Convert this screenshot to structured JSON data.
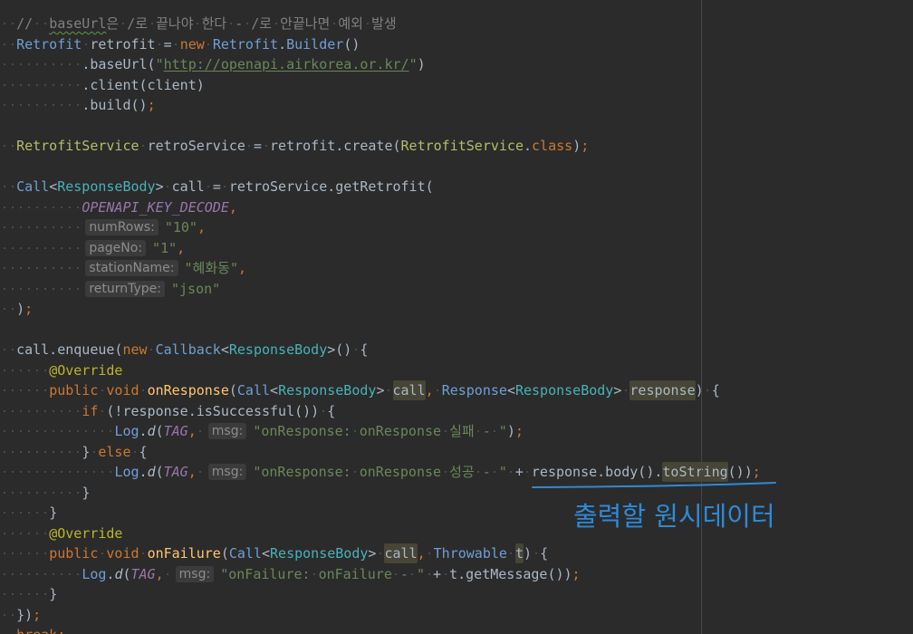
{
  "editor": {
    "lines": [
      [
        {
          "t": "  //  ",
          "c": "#808080"
        },
        {
          "t": "baseUrl",
          "c": "#808080",
          "wavy": true
        },
        {
          "t": "은 /로 끝나야 한다 - /로 안끝나면 예외 발생",
          "c": "#808080"
        }
      ],
      [
        {
          "t": "  "
        },
        {
          "t": "Retrofit",
          "c": "#6e9fd6"
        },
        {
          "t": " retrofit = "
        },
        {
          "t": "new",
          "c": "#cc7832"
        },
        {
          "t": " "
        },
        {
          "t": "Retrofit",
          "c": "#6e9fd6"
        },
        {
          "t": "."
        },
        {
          "t": "Builder",
          "c": "#6e9fd6"
        },
        {
          "t": "()"
        }
      ],
      [
        {
          "t": "          .baseUrl("
        },
        {
          "t": "\"",
          "c": "#6a8759"
        },
        {
          "t": "http://openapi.airkorea.or.kr/",
          "c": "#6a8759",
          "link": true
        },
        {
          "t": "\"",
          "c": "#6a8759"
        },
        {
          "t": ")"
        }
      ],
      [
        {
          "t": "          .client(client)"
        }
      ],
      [
        {
          "t": "          .build()"
        },
        {
          "t": ";",
          "c": "#cc7832"
        }
      ],
      [],
      [
        {
          "t": "  "
        },
        {
          "t": "RetrofitService",
          "c": "#b5bd68"
        },
        {
          "t": " retroService = retrofit.create("
        },
        {
          "t": "RetrofitService",
          "c": "#b5bd68"
        },
        {
          "t": "."
        },
        {
          "t": "class",
          "c": "#cc7832"
        },
        {
          "t": ")"
        },
        {
          "t": ";",
          "c": "#cc7832"
        }
      ],
      [],
      [
        {
          "t": "  "
        },
        {
          "t": "Call",
          "c": "#6e9fd6"
        },
        {
          "t": "<"
        },
        {
          "t": "ResponseBody",
          "c": "#47b2b8"
        },
        {
          "t": "> call = retroService.getRetrofit("
        }
      ],
      [
        {
          "t": "          "
        },
        {
          "t": "OPENAPI_KEY_DECODE",
          "c": "#9876aa",
          "i": true
        },
        {
          "t": ",",
          "c": "#cc7832"
        }
      ],
      [
        {
          "t": "          "
        },
        {
          "t": "numRows:",
          "hint": true
        },
        {
          "t": "\"10\"",
          "c": "#6a8759"
        },
        {
          "t": ",",
          "c": "#cc7832"
        }
      ],
      [
        {
          "t": "          "
        },
        {
          "t": "pageNo:",
          "hint": true
        },
        {
          "t": "\"1\"",
          "c": "#6a8759"
        },
        {
          "t": ",",
          "c": "#cc7832"
        }
      ],
      [
        {
          "t": "          "
        },
        {
          "t": "stationName:",
          "hint": true
        },
        {
          "t": "\"혜화동\"",
          "c": "#6a8759"
        },
        {
          "t": ",",
          "c": "#cc7832"
        }
      ],
      [
        {
          "t": "          "
        },
        {
          "t": "returnType:",
          "hint": true
        },
        {
          "t": "\"json\"",
          "c": "#6a8759"
        }
      ],
      [
        {
          "t": "  )"
        },
        {
          "t": ";",
          "c": "#cc7832"
        }
      ],
      [],
      [
        {
          "t": "  call.enqueue("
        },
        {
          "t": "new",
          "c": "#cc7832"
        },
        {
          "t": " "
        },
        {
          "t": "Callback",
          "c": "#6e9fd6"
        },
        {
          "t": "<"
        },
        {
          "t": "ResponseBody",
          "c": "#47b2b8"
        },
        {
          "t": ">() {"
        }
      ],
      [
        {
          "t": "      "
        },
        {
          "t": "@Override",
          "c": "#bbb529"
        }
      ],
      [
        {
          "t": "      "
        },
        {
          "t": "public void",
          "c": "#cc7832"
        },
        {
          "t": " "
        },
        {
          "t": "onResponse",
          "c": "#ffc66d"
        },
        {
          "t": "("
        },
        {
          "t": "Call",
          "c": "#6e9fd6"
        },
        {
          "t": "<"
        },
        {
          "t": "ResponseBody",
          "c": "#47b2b8"
        },
        {
          "t": "> "
        },
        {
          "t": "call",
          "bg": "#474536"
        },
        {
          "t": ",",
          "c": "#cc7832"
        },
        {
          "t": " "
        },
        {
          "t": "Response",
          "c": "#6e9fd6"
        },
        {
          "t": "<"
        },
        {
          "t": "ResponseBody",
          "c": "#47b2b8"
        },
        {
          "t": "> "
        },
        {
          "t": "response",
          "bg": "#474536"
        },
        {
          "t": ") {"
        }
      ],
      [
        {
          "t": "          "
        },
        {
          "t": "if",
          "c": "#cc7832"
        },
        {
          "t": " (!response.isSuccessful()) {"
        }
      ],
      [
        {
          "t": "              "
        },
        {
          "t": "Log",
          "c": "#6e9fd6"
        },
        {
          "t": "."
        },
        {
          "t": "d",
          "i": true
        },
        {
          "t": "("
        },
        {
          "t": "TAG",
          "c": "#9876aa",
          "i": true
        },
        {
          "t": ",",
          "c": "#cc7832"
        },
        {
          "t": " "
        },
        {
          "t": "msg:",
          "hint": true
        },
        {
          "t": "\"onResponse: onResponse 실패 - \"",
          "c": "#6a8759"
        },
        {
          "t": ")"
        },
        {
          "t": ";",
          "c": "#cc7832"
        }
      ],
      [
        {
          "t": "          } "
        },
        {
          "t": "else",
          "c": "#cc7832"
        },
        {
          "t": " {"
        }
      ],
      [
        {
          "t": "              "
        },
        {
          "t": "Log",
          "c": "#6e9fd6"
        },
        {
          "t": "."
        },
        {
          "t": "d",
          "i": true
        },
        {
          "t": "("
        },
        {
          "t": "TAG",
          "c": "#9876aa",
          "i": true
        },
        {
          "t": ",",
          "c": "#cc7832"
        },
        {
          "t": " "
        },
        {
          "t": "msg:",
          "hint": true
        },
        {
          "t": "\"onResponse: onResponse 성공 - \"",
          "c": "#6a8759"
        },
        {
          "t": " + response.body()."
        },
        {
          "t": "toString",
          "bg": "#474536"
        },
        {
          "t": "())"
        },
        {
          "t": ";",
          "c": "#cc7832"
        }
      ],
      [
        {
          "t": "          }"
        }
      ],
      [
        {
          "t": "      }"
        }
      ],
      [
        {
          "t": "      "
        },
        {
          "t": "@Override",
          "c": "#bbb529"
        }
      ],
      [
        {
          "t": "      "
        },
        {
          "t": "public void",
          "c": "#cc7832"
        },
        {
          "t": " "
        },
        {
          "t": "onFailure",
          "c": "#ffc66d"
        },
        {
          "t": "("
        },
        {
          "t": "Call",
          "c": "#6e9fd6"
        },
        {
          "t": "<"
        },
        {
          "t": "ResponseBody",
          "c": "#47b2b8"
        },
        {
          "t": "> "
        },
        {
          "t": "call",
          "bg": "#474536"
        },
        {
          "t": ",",
          "c": "#cc7832"
        },
        {
          "t": " "
        },
        {
          "t": "Throwable",
          "c": "#6e9fd6"
        },
        {
          "t": " "
        },
        {
          "t": "t",
          "bg": "#474536"
        },
        {
          "t": ") {"
        }
      ],
      [
        {
          "t": "          "
        },
        {
          "t": "Log",
          "c": "#6e9fd6"
        },
        {
          "t": "."
        },
        {
          "t": "d",
          "i": true
        },
        {
          "t": "("
        },
        {
          "t": "TAG",
          "c": "#9876aa",
          "i": true
        },
        {
          "t": ",",
          "c": "#cc7832"
        },
        {
          "t": " "
        },
        {
          "t": "msg:",
          "hint": true
        },
        {
          "t": "\"onFailure: onFailure - \"",
          "c": "#6a8759"
        },
        {
          "t": " + t.getMessage())"
        },
        {
          "t": ";",
          "c": "#cc7832"
        }
      ],
      [
        {
          "t": "      }"
        }
      ],
      [
        {
          "t": "  })"
        },
        {
          "t": ";",
          "c": "#cc7832"
        }
      ],
      [
        {
          "t": "  "
        },
        {
          "t": "break",
          "c": "#cc7832"
        },
        {
          "t": ";",
          "c": "#cc7832"
        }
      ]
    ]
  },
  "annotation": {
    "label": "출력할 원시데이터",
    "color": "#2d8ad8"
  }
}
